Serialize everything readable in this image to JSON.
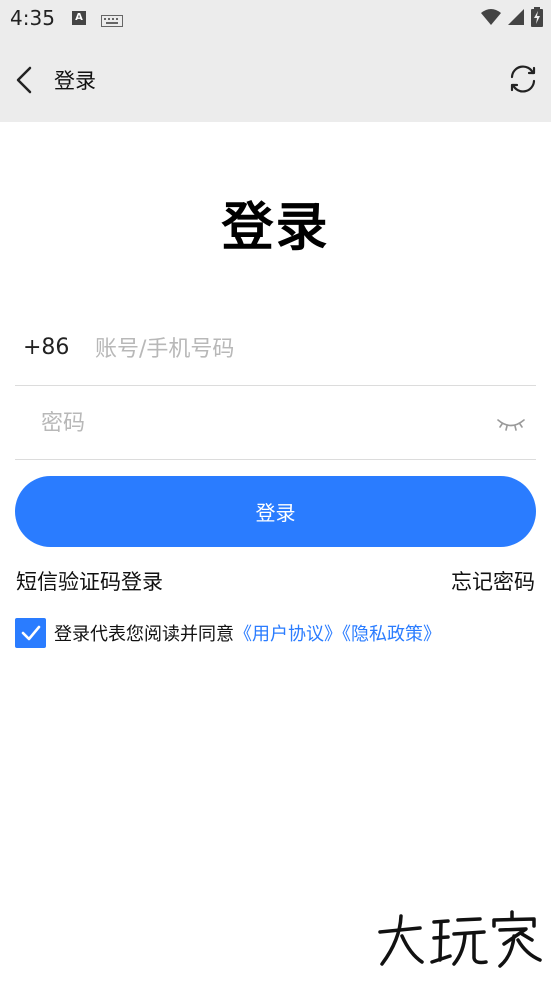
{
  "status_bar": {
    "time": "4:35",
    "icons": [
      "a-notification-icon",
      "keyboard-icon",
      "wifi-icon",
      "signal-icon",
      "battery-charging-icon"
    ]
  },
  "app_bar": {
    "title": "登录",
    "back_icon": "chevron-left-icon",
    "refresh_icon": "refresh-icon"
  },
  "page": {
    "heading": "登录"
  },
  "form": {
    "country_code": "+86",
    "account_placeholder": "账号/手机号码",
    "account_value": "",
    "password_placeholder": "密码",
    "password_value": "",
    "eye_icon": "eye-closed-icon",
    "login_button": "登录",
    "sms_login": "短信验证码登录",
    "forgot_password": "忘记密码"
  },
  "agreement": {
    "checked": true,
    "prefix_text": "登录代表您阅读并同意",
    "user_agreement": "《用户协议》",
    "privacy_policy": "《隐私政策》"
  },
  "watermark": {
    "text": "大玩家"
  },
  "colors": {
    "accent": "#2a7cff",
    "appbar_bg": "#ececec",
    "divider": "#dcdcdc",
    "placeholder": "#b8b8b8"
  }
}
